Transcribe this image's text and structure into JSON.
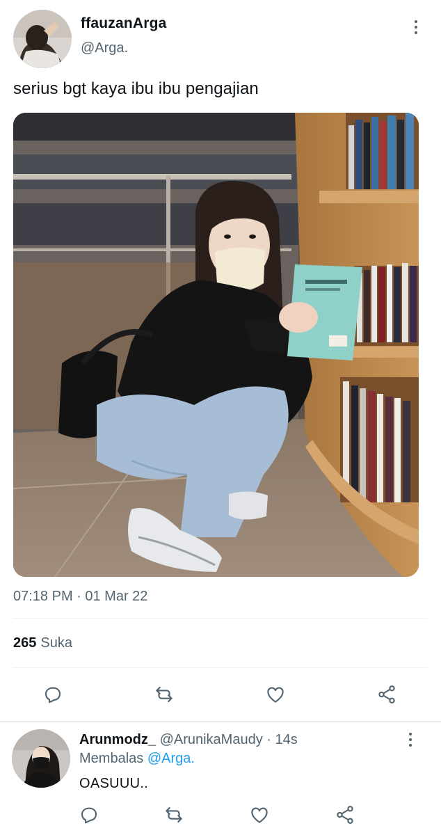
{
  "tweet": {
    "author": {
      "display_name": "ffauzanArga",
      "handle": "@Arga."
    },
    "text": "serius bgt kaya ibu ibu pengajian",
    "timestamp": "07:18 PM · 01 Mar 22",
    "likes": {
      "count": "265",
      "label": "Suka"
    },
    "actions": [
      "reply-icon",
      "retweet-icon",
      "like-icon",
      "share-icon"
    ]
  },
  "reply": {
    "display_name": "Arunmodz_",
    "handle_time": "@ArunikaMaudy · 14s",
    "replying_label": "Membalas",
    "replying_to": "@Arga.",
    "text": "OASUUU..",
    "actions": [
      "reply-icon",
      "retweet-icon",
      "like-icon",
      "share-icon"
    ]
  },
  "colors": {
    "text_primary": "#0f1419",
    "text_secondary": "#536471",
    "link": "#1d9bf0",
    "divider": "#eff3f4"
  }
}
